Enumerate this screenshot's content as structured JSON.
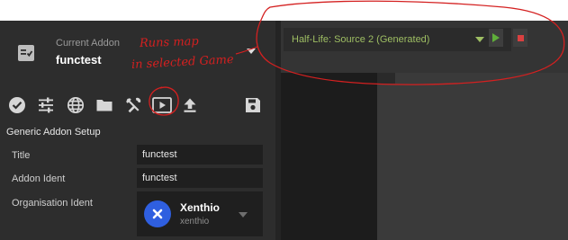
{
  "addon": {
    "caption": "Current Addon",
    "name": "functest"
  },
  "toolbar": {
    "icons": [
      "check-circle-icon",
      "sliders-icon",
      "globe-icon",
      "folder-icon",
      "tools-icon",
      "play-icon",
      "upload-icon",
      "save-icon"
    ]
  },
  "setup": {
    "title": "Generic Addon Setup",
    "fields": [
      {
        "label": "Title",
        "value": "functest"
      },
      {
        "label": "Addon Ident",
        "value": "functest"
      }
    ],
    "org_label": "Organisation Ident",
    "org": {
      "name": "Xenthio",
      "ident": "xenthio"
    }
  },
  "game": {
    "name": "Half-Life: Source 2 (Generated)"
  },
  "annotation": {
    "line1": "Runs map",
    "line2": "in selected Game"
  },
  "colors": {
    "annotation": "#d42020",
    "game_name": "#9ebe63",
    "play": "#5fae3a",
    "stop": "#d94040",
    "avatar": "#2f5fe0"
  }
}
